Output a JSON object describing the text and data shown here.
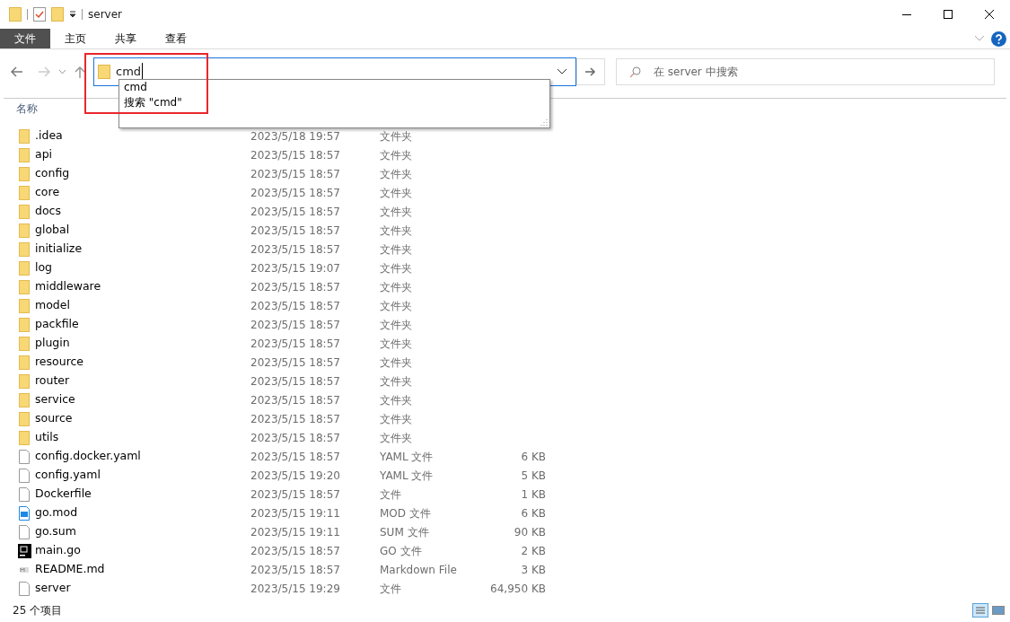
{
  "window": {
    "title": "server"
  },
  "ribbon_tabs": [
    {
      "label": "文件",
      "selected": true
    },
    {
      "label": "主页",
      "selected": false
    },
    {
      "label": "共享",
      "selected": false
    },
    {
      "label": "查看",
      "selected": false
    }
  ],
  "address": {
    "value": "cmd",
    "suggestions": [
      "cmd",
      "搜索 \"cmd\""
    ]
  },
  "search": {
    "placeholder": "在 server 中搜索"
  },
  "table": {
    "columns": [
      "名称"
    ],
    "rows": [
      {
        "kind": "folder",
        "name": ".idea",
        "date": "2023/5/18 19:57",
        "type": "文件夹",
        "size": ""
      },
      {
        "kind": "folder",
        "name": "api",
        "date": "2023/5/15 18:57",
        "type": "文件夹",
        "size": ""
      },
      {
        "kind": "folder",
        "name": "config",
        "date": "2023/5/15 18:57",
        "type": "文件夹",
        "size": ""
      },
      {
        "kind": "folder",
        "name": "core",
        "date": "2023/5/15 18:57",
        "type": "文件夹",
        "size": ""
      },
      {
        "kind": "folder",
        "name": "docs",
        "date": "2023/5/15 18:57",
        "type": "文件夹",
        "size": ""
      },
      {
        "kind": "folder",
        "name": "global",
        "date": "2023/5/15 18:57",
        "type": "文件夹",
        "size": ""
      },
      {
        "kind": "folder",
        "name": "initialize",
        "date": "2023/5/15 18:57",
        "type": "文件夹",
        "size": ""
      },
      {
        "kind": "folder",
        "name": "log",
        "date": "2023/5/15 19:07",
        "type": "文件夹",
        "size": ""
      },
      {
        "kind": "folder",
        "name": "middleware",
        "date": "2023/5/15 18:57",
        "type": "文件夹",
        "size": ""
      },
      {
        "kind": "folder",
        "name": "model",
        "date": "2023/5/15 18:57",
        "type": "文件夹",
        "size": ""
      },
      {
        "kind": "folder",
        "name": "packfile",
        "date": "2023/5/15 18:57",
        "type": "文件夹",
        "size": ""
      },
      {
        "kind": "folder",
        "name": "plugin",
        "date": "2023/5/15 18:57",
        "type": "文件夹",
        "size": ""
      },
      {
        "kind": "folder",
        "name": "resource",
        "date": "2023/5/15 18:57",
        "type": "文件夹",
        "size": ""
      },
      {
        "kind": "folder",
        "name": "router",
        "date": "2023/5/15 18:57",
        "type": "文件夹",
        "size": ""
      },
      {
        "kind": "folder",
        "name": "service",
        "date": "2023/5/15 18:57",
        "type": "文件夹",
        "size": ""
      },
      {
        "kind": "folder",
        "name": "source",
        "date": "2023/5/15 18:57",
        "type": "文件夹",
        "size": ""
      },
      {
        "kind": "folder",
        "name": "utils",
        "date": "2023/5/15 18:57",
        "type": "文件夹",
        "size": ""
      },
      {
        "kind": "file",
        "name": "config.docker.yaml",
        "date": "2023/5/15 18:57",
        "type": "YAML 文件",
        "size": "6 KB"
      },
      {
        "kind": "file",
        "name": "config.yaml",
        "date": "2023/5/15 19:20",
        "type": "YAML 文件",
        "size": "5 KB"
      },
      {
        "kind": "file",
        "name": "Dockerfile",
        "date": "2023/5/15 18:57",
        "type": "文件",
        "size": "1 KB"
      },
      {
        "kind": "mod",
        "name": "go.mod",
        "date": "2023/5/15 19:11",
        "type": "MOD 文件",
        "size": "6 KB"
      },
      {
        "kind": "file",
        "name": "go.sum",
        "date": "2023/5/15 19:11",
        "type": "SUM 文件",
        "size": "90 KB"
      },
      {
        "kind": "ide",
        "name": "main.go",
        "date": "2023/5/15 18:57",
        "type": "GO 文件",
        "size": "2 KB"
      },
      {
        "kind": "markdown",
        "name": "README.md",
        "date": "2023/5/15 18:57",
        "type": "Markdown File",
        "size": "3 KB"
      },
      {
        "kind": "file",
        "name": "server",
        "date": "2023/5/15 19:29",
        "type": "文件",
        "size": "64,950 KB"
      }
    ]
  },
  "status_bar": {
    "item_count": "25 个项目"
  }
}
